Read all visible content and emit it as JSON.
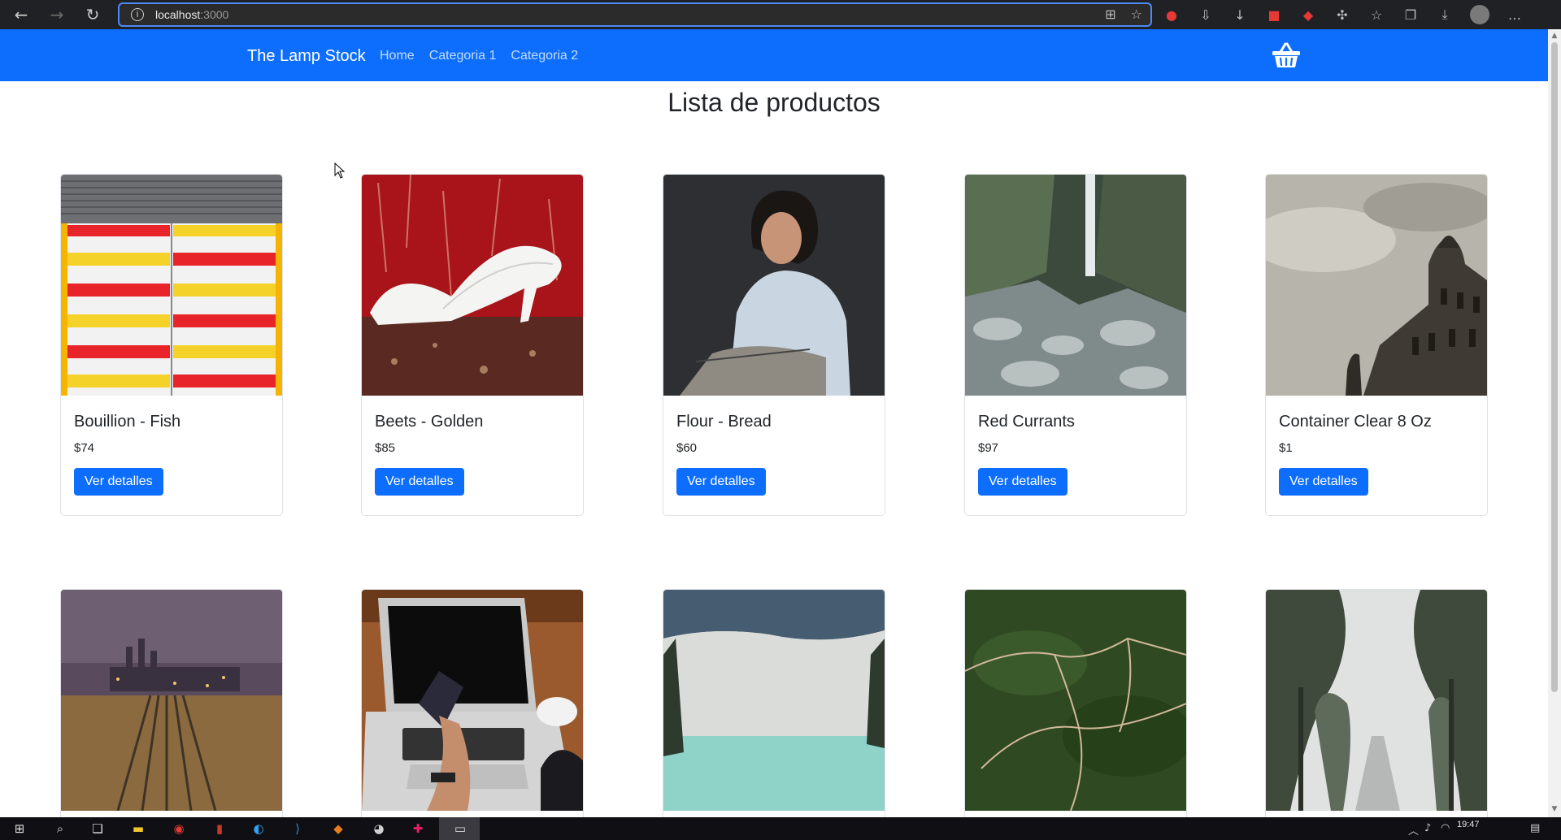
{
  "browser": {
    "url_host": "localhost",
    "url_port": ":3000"
  },
  "navbar": {
    "brand": "The Lamp Stock",
    "links": [
      "Home",
      "Categoria 1",
      "Categoria 2"
    ]
  },
  "page": {
    "heading": "Lista de productos"
  },
  "products": [
    {
      "name": "Bouillion - Fish",
      "price": "$74",
      "button": "Ver detalles"
    },
    {
      "name": "Beets - Golden",
      "price": "$85",
      "button": "Ver detalles"
    },
    {
      "name": "Flour - Bread",
      "price": "$60",
      "button": "Ver detalles"
    },
    {
      "name": "Red Currants",
      "price": "$97",
      "button": "Ver detalles"
    },
    {
      "name": "Container Clear 8 Oz",
      "price": "$1",
      "button": "Ver detalles"
    }
  ],
  "taskbar": {
    "time": "19:47"
  },
  "colors": {
    "primary": "#0d6efd"
  }
}
